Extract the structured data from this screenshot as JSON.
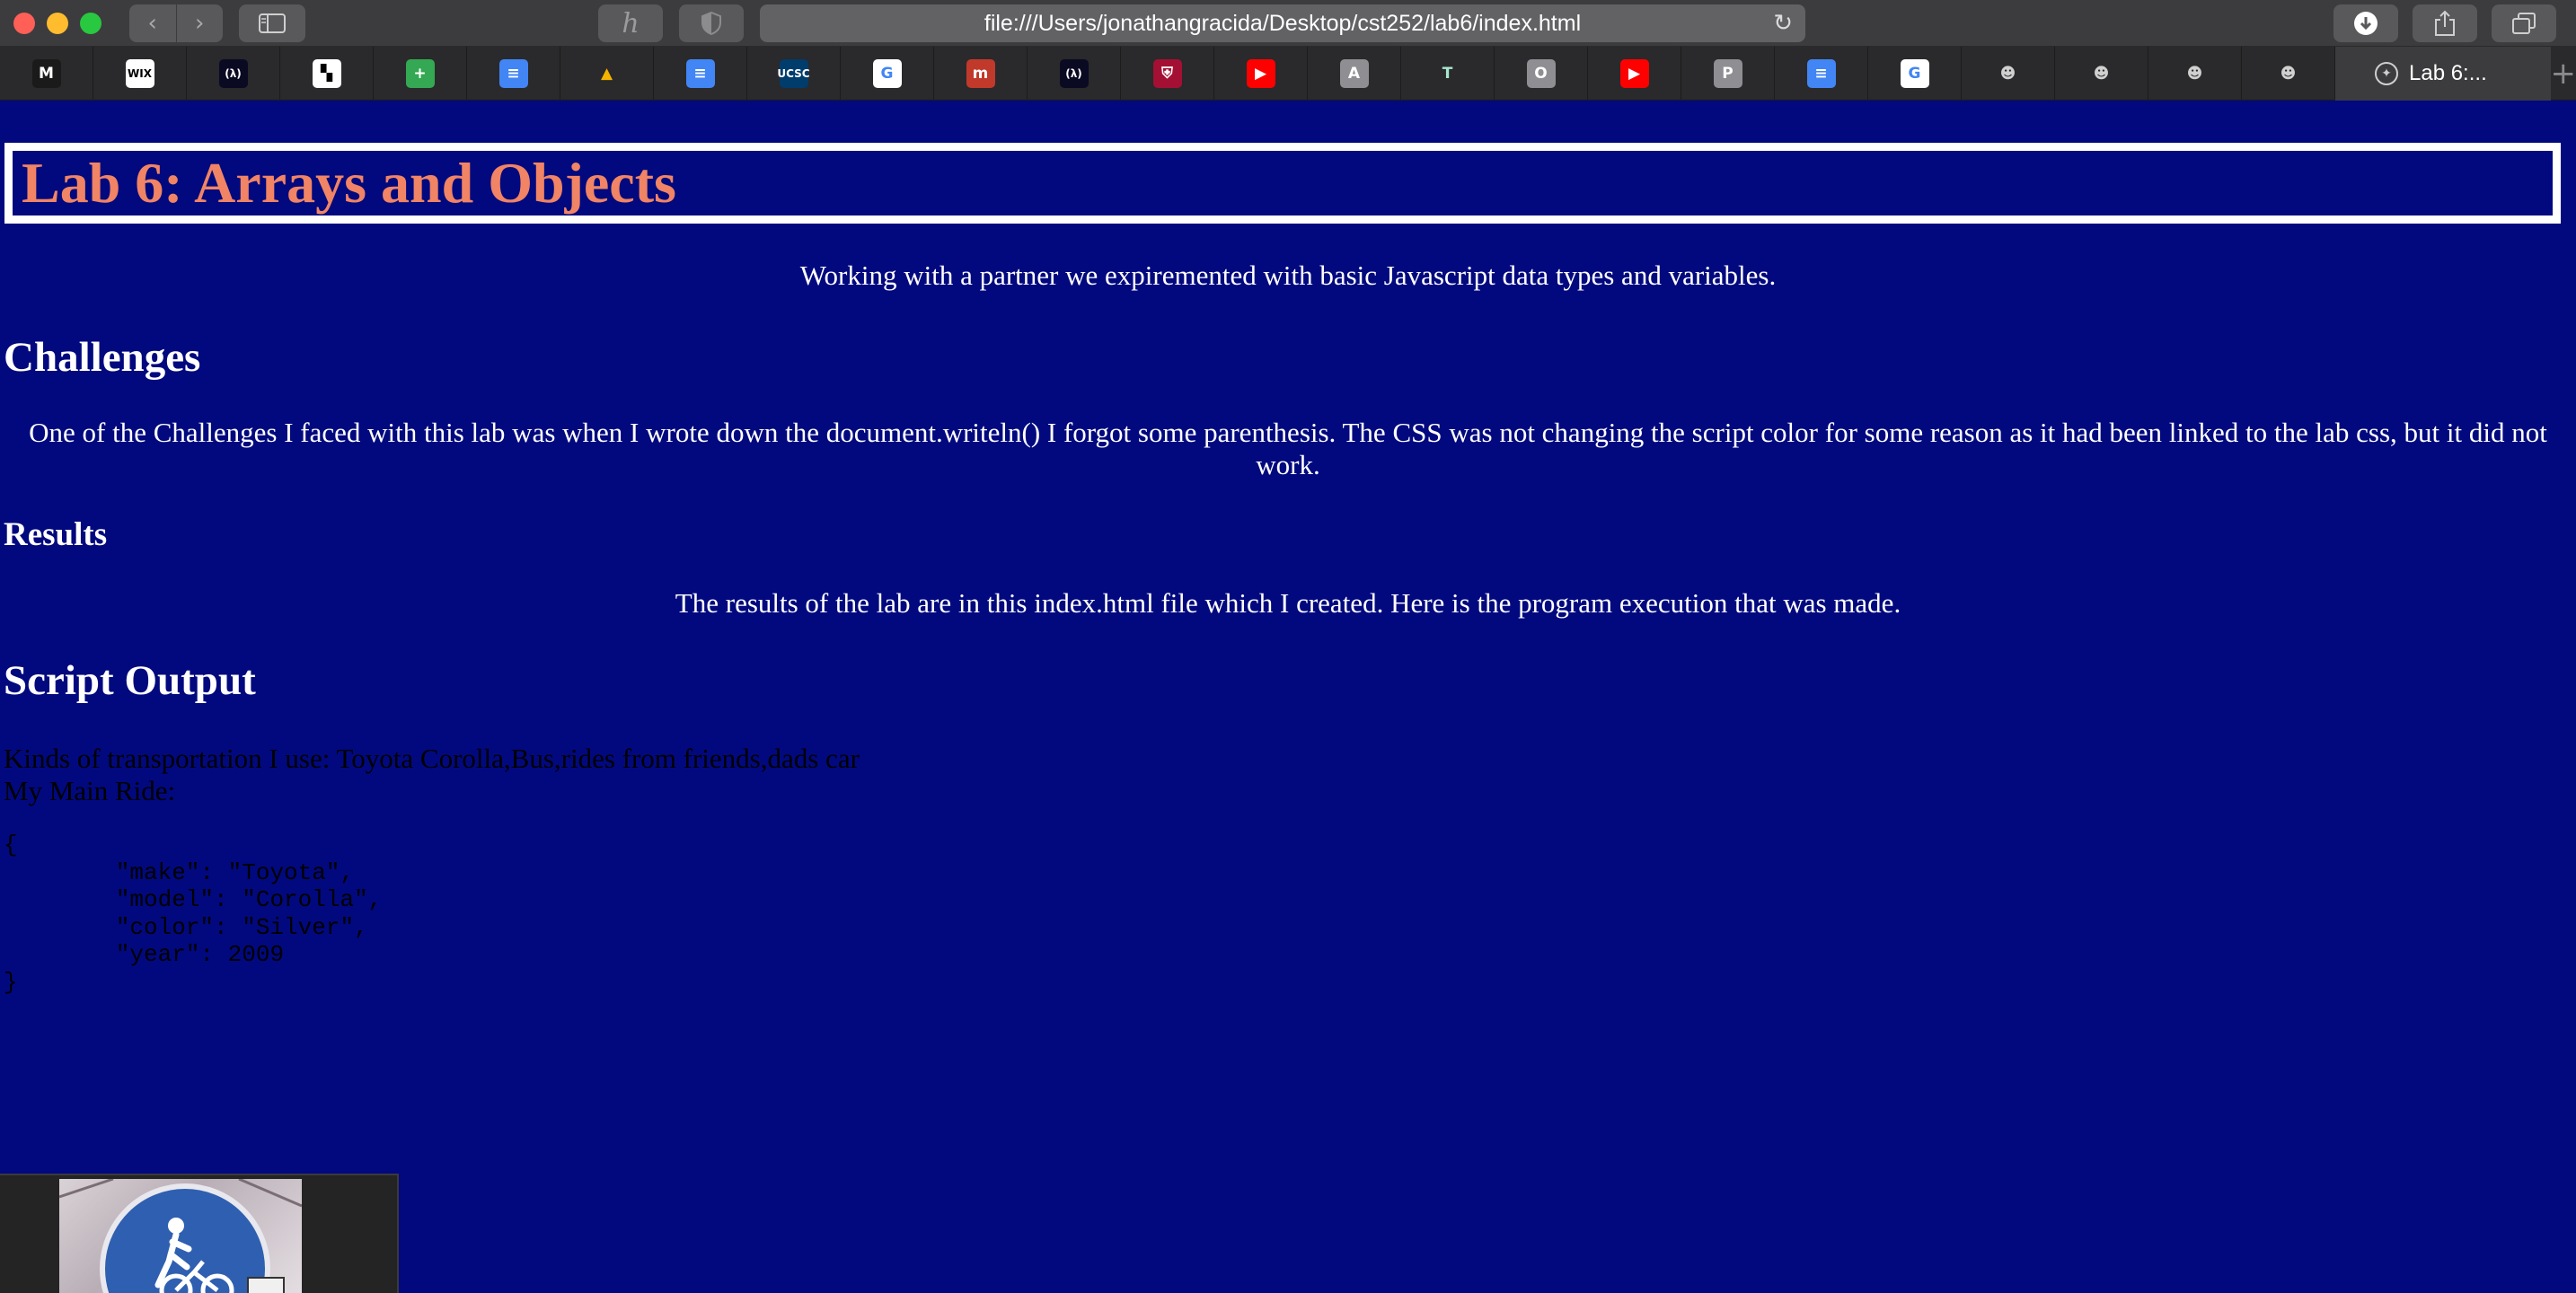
{
  "browser": {
    "url": "file:///Users/jonathangracida/Desktop/cst252/lab6/index.html",
    "active_tab_title": "Lab 6:...",
    "pinned_tabs": [
      {
        "icon": "medium-icon",
        "glyph": "M",
        "bg": "#1a1a1a",
        "fg": "#ffffff"
      },
      {
        "icon": "wix-icon",
        "glyph": "WIX",
        "bg": "#ffffff",
        "fg": "#000000"
      },
      {
        "icon": "freecodecamp-icon",
        "glyph": "(λ)",
        "bg": "#0a0a23",
        "fg": "#ffffff"
      },
      {
        "icon": "chess-icon",
        "glyph": "▚",
        "bg": "#ffffff",
        "fg": "#000000"
      },
      {
        "icon": "google-sheets-add-icon",
        "glyph": "+",
        "bg": "#34a853",
        "fg": "#ffffff"
      },
      {
        "icon": "google-docs-icon",
        "glyph": "≡",
        "bg": "#4285f4",
        "fg": "#ffffff"
      },
      {
        "icon": "google-drive-icon",
        "glyph": "▲",
        "bg": "#2a292b",
        "fg": "#f4b400"
      },
      {
        "icon": "google-docs-icon",
        "glyph": "≡",
        "bg": "#4285f4",
        "fg": "#ffffff"
      },
      {
        "icon": "ucsc-icon",
        "glyph": "UCSC",
        "bg": "#003c6c",
        "fg": "#ffffff"
      },
      {
        "icon": "google-icon",
        "glyph": "G",
        "bg": "#ffffff",
        "fg": "#4285f4"
      },
      {
        "icon": "moodle-icon",
        "glyph": "m",
        "bg": "#c0392b",
        "fg": "#ffffff"
      },
      {
        "icon": "freecodecamp-icon",
        "glyph": "(λ)",
        "bg": "#0a0a23",
        "fg": "#ffffff"
      },
      {
        "icon": "harvard-icon",
        "glyph": "⛨",
        "bg": "#a41034",
        "fg": "#ffffff"
      },
      {
        "icon": "youtube-icon",
        "glyph": "▶",
        "bg": "#ff0000",
        "fg": "#ffffff"
      },
      {
        "icon": "letter-a-icon",
        "glyph": "A",
        "bg": "#8e8e93",
        "fg": "#ffffff"
      },
      {
        "icon": "letter-t-icon",
        "glyph": "T",
        "bg": "#2a292b",
        "fg": "#a8e6cf"
      },
      {
        "icon": "letter-o-icon",
        "glyph": "O",
        "bg": "#8e8e93",
        "fg": "#ffffff"
      },
      {
        "icon": "youtube-icon",
        "glyph": "▶",
        "bg": "#ff0000",
        "fg": "#ffffff"
      },
      {
        "icon": "letter-p-icon",
        "glyph": "P",
        "bg": "#8e8e93",
        "fg": "#ffffff"
      },
      {
        "icon": "google-docs-icon",
        "glyph": "≡",
        "bg": "#4285f4",
        "fg": "#ffffff"
      },
      {
        "icon": "google-icon",
        "glyph": "G",
        "bg": "#ffffff",
        "fg": "#4285f4"
      },
      {
        "icon": "github-icon",
        "glyph": "☻",
        "bg": "#2a292b",
        "fg": "#d0d0d0"
      },
      {
        "icon": "github-icon",
        "glyph": "☻",
        "bg": "#2a292b",
        "fg": "#d0d0d0"
      },
      {
        "icon": "github-icon",
        "glyph": "☻",
        "bg": "#2a292b",
        "fg": "#d0d0d0"
      },
      {
        "icon": "github-icon",
        "glyph": "☻",
        "bg": "#2a292b",
        "fg": "#d0d0d0"
      }
    ]
  },
  "page": {
    "title": "Lab 6: Arrays and Objects",
    "intro": "Working with a partner we expiremented with basic Javascript data types and variables.",
    "challenges_heading": "Challenges",
    "challenges_text": "One of the Challenges I faced with this lab was when I wrote down the document.writeln() I forgot some parenthesis. The CSS was not changing the script color for some reason as it had been linked to the lab css, but it did not work.",
    "results_heading": "Results",
    "results_text": "The results of the lab are in this index.html file which I created. Here is the program execution that was made.",
    "script_heading": "Script Output",
    "transport_line": "Kinds of transportation I use: Toyota Corolla,Bus,rides from friends,dads car",
    "main_ride_label": "My Main Ride:",
    "main_ride_json": "{\n        \"make\": \"Toyota\",\n        \"model\": \"Corolla\",\n        \"color\": \"Silver\",\n        \"year\": 2009\n}"
  },
  "colors": {
    "page_bg": "#02097e",
    "title_color": "#f08465",
    "text": "#ffffff",
    "script_text": "#000000"
  }
}
